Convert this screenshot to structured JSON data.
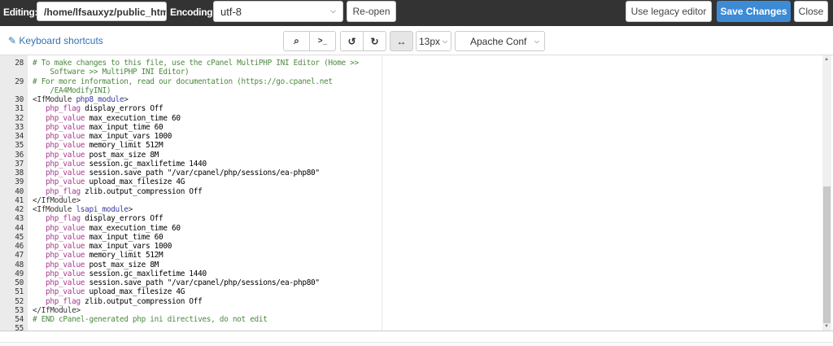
{
  "header": {
    "editing_label": "Editing:",
    "file_path": "/home/lfsauxyz/public_html",
    "encoding_label": "Encoding:",
    "encoding_value": "utf-8",
    "reopen": "Re-open",
    "legacy": "Use legacy editor",
    "save": "Save Changes",
    "close": "Close"
  },
  "toolbar": {
    "shortcuts": "Keyboard shortcuts",
    "font_size": "13px",
    "mode": "Apache Conf",
    "search_icon": "⌕",
    "terminal_icon": ">_",
    "undo_icon": "↺",
    "redo_icon": "↻",
    "wrap_icon": "↔"
  },
  "colors": {
    "primary": "#3d8bd5",
    "topbar": "#333333",
    "comment": "#4b8a3e",
    "keyword": "#a63a8e"
  },
  "scroll": {
    "position_fraction": 1.0
  },
  "lines": [
    {
      "n": "28",
      "rows": [
        [
          [
            "c-comment",
            "# To make changes to this file, use the cPanel MultiPHP INI Editor (Home >>"
          ]
        ],
        [
          [
            "c-comment",
            "    Software >> MultiPHP INI Editor)"
          ]
        ]
      ]
    },
    {
      "n": "29",
      "rows": [
        [
          [
            "c-comment",
            "# For more information, read our documentation (https://go.cpanel.net"
          ]
        ],
        [
          [
            "c-comment",
            "    /EA4ModifyINI)"
          ]
        ]
      ]
    },
    {
      "n": "30",
      "rows": [
        [
          [
            "c-tag",
            "<IfModule "
          ],
          [
            "c-mod",
            "php8_module"
          ],
          [
            "c-tag",
            ">"
          ]
        ]
      ]
    },
    {
      "n": "31",
      "rows": [
        [
          [
            "",
            "   "
          ],
          [
            "c-kw",
            "php_flag"
          ],
          [
            "",
            " display_errors Off"
          ]
        ]
      ]
    },
    {
      "n": "32",
      "rows": [
        [
          [
            "",
            "   "
          ],
          [
            "c-kw",
            "php_value"
          ],
          [
            "",
            " max_execution_time 60"
          ]
        ]
      ]
    },
    {
      "n": "33",
      "rows": [
        [
          [
            "",
            "   "
          ],
          [
            "c-kw",
            "php_value"
          ],
          [
            "",
            " max_input_time 60"
          ]
        ]
      ]
    },
    {
      "n": "34",
      "rows": [
        [
          [
            "",
            "   "
          ],
          [
            "c-kw",
            "php_value"
          ],
          [
            "",
            " max_input_vars 1000"
          ]
        ]
      ]
    },
    {
      "n": "35",
      "rows": [
        [
          [
            "",
            "   "
          ],
          [
            "c-kw",
            "php_value"
          ],
          [
            "",
            " memory_limit 512M"
          ]
        ]
      ]
    },
    {
      "n": "36",
      "rows": [
        [
          [
            "",
            "   "
          ],
          [
            "c-kw",
            "php_value"
          ],
          [
            "",
            " post_max_size 8M"
          ]
        ]
      ]
    },
    {
      "n": "37",
      "rows": [
        [
          [
            "",
            "   "
          ],
          [
            "c-kw",
            "php_value"
          ],
          [
            "",
            " session.gc_maxlifetime 1440"
          ]
        ]
      ]
    },
    {
      "n": "38",
      "rows": [
        [
          [
            "",
            "   "
          ],
          [
            "c-kw",
            "php_value"
          ],
          [
            "",
            " session.save_path \"/var/cpanel/php/sessions/ea-php80\""
          ]
        ]
      ]
    },
    {
      "n": "39",
      "rows": [
        [
          [
            "",
            "   "
          ],
          [
            "c-kw",
            "php_value"
          ],
          [
            "",
            " upload_max_filesize 4G"
          ]
        ]
      ]
    },
    {
      "n": "40",
      "rows": [
        [
          [
            "",
            "   "
          ],
          [
            "c-kw",
            "php_flag"
          ],
          [
            "",
            " zlib.output_compression Off"
          ]
        ]
      ]
    },
    {
      "n": "41",
      "rows": [
        [
          [
            "c-tag",
            "</IfModule>"
          ]
        ]
      ]
    },
    {
      "n": "42",
      "rows": [
        [
          [
            "c-tag",
            "<IfModule "
          ],
          [
            "c-mod",
            "lsapi_module"
          ],
          [
            "c-tag",
            ">"
          ]
        ]
      ]
    },
    {
      "n": "43",
      "rows": [
        [
          [
            "",
            "   "
          ],
          [
            "c-kw",
            "php_flag"
          ],
          [
            "",
            " display_errors Off"
          ]
        ]
      ]
    },
    {
      "n": "44",
      "rows": [
        [
          [
            "",
            "   "
          ],
          [
            "c-kw",
            "php_value"
          ],
          [
            "",
            " max_execution_time 60"
          ]
        ]
      ]
    },
    {
      "n": "45",
      "rows": [
        [
          [
            "",
            "   "
          ],
          [
            "c-kw",
            "php_value"
          ],
          [
            "",
            " max_input_time 60"
          ]
        ]
      ]
    },
    {
      "n": "46",
      "rows": [
        [
          [
            "",
            "   "
          ],
          [
            "c-kw",
            "php_value"
          ],
          [
            "",
            " max_input_vars 1000"
          ]
        ]
      ]
    },
    {
      "n": "47",
      "rows": [
        [
          [
            "",
            "   "
          ],
          [
            "c-kw",
            "php_value"
          ],
          [
            "",
            " memory_limit 512M"
          ]
        ]
      ]
    },
    {
      "n": "48",
      "rows": [
        [
          [
            "",
            "   "
          ],
          [
            "c-kw",
            "php_value"
          ],
          [
            "",
            " post_max_size 8M"
          ]
        ]
      ]
    },
    {
      "n": "49",
      "rows": [
        [
          [
            "",
            "   "
          ],
          [
            "c-kw",
            "php_value"
          ],
          [
            "",
            " session.gc_maxlifetime 1440"
          ]
        ]
      ]
    },
    {
      "n": "50",
      "rows": [
        [
          [
            "",
            "   "
          ],
          [
            "c-kw",
            "php_value"
          ],
          [
            "",
            " session.save_path \"/var/cpanel/php/sessions/ea-php80\""
          ]
        ]
      ]
    },
    {
      "n": "51",
      "rows": [
        [
          [
            "",
            "   "
          ],
          [
            "c-kw",
            "php_value"
          ],
          [
            "",
            " upload_max_filesize 4G"
          ]
        ]
      ]
    },
    {
      "n": "52",
      "rows": [
        [
          [
            "",
            "   "
          ],
          [
            "c-kw",
            "php_flag"
          ],
          [
            "",
            " zlib.output_compression Off"
          ]
        ]
      ]
    },
    {
      "n": "53",
      "rows": [
        [
          [
            "c-tag",
            "</IfModule>"
          ]
        ]
      ]
    },
    {
      "n": "54",
      "rows": [
        [
          [
            "c-comment",
            "# END cPanel-generated php ini directives, do not edit"
          ]
        ]
      ]
    },
    {
      "n": "55",
      "rows": [
        [
          [
            "",
            ""
          ]
        ]
      ]
    }
  ]
}
